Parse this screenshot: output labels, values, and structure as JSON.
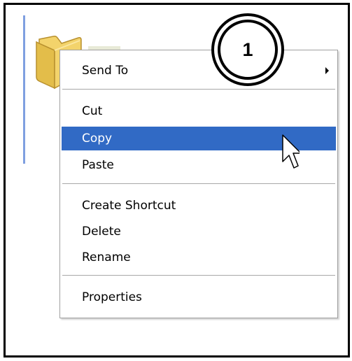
{
  "step_badge": {
    "number": "1"
  },
  "context_menu": {
    "items": [
      {
        "label": "Send To",
        "has_submenu": true
      },
      {
        "label": "Cut"
      },
      {
        "label": "Copy",
        "highlighted": true
      },
      {
        "label": "Paste"
      },
      {
        "label": "Create Shortcut"
      },
      {
        "label": "Delete"
      },
      {
        "label": "Rename"
      },
      {
        "label": "Properties"
      }
    ]
  },
  "colors": {
    "highlight": "#316ac5",
    "highlight_text": "#ffffff",
    "selection_bar": "#7f9fe0",
    "folder": "#f3d36b"
  },
  "icons": [
    "folder-icon",
    "submenu-arrow-icon",
    "mouse-pointer-icon"
  ]
}
